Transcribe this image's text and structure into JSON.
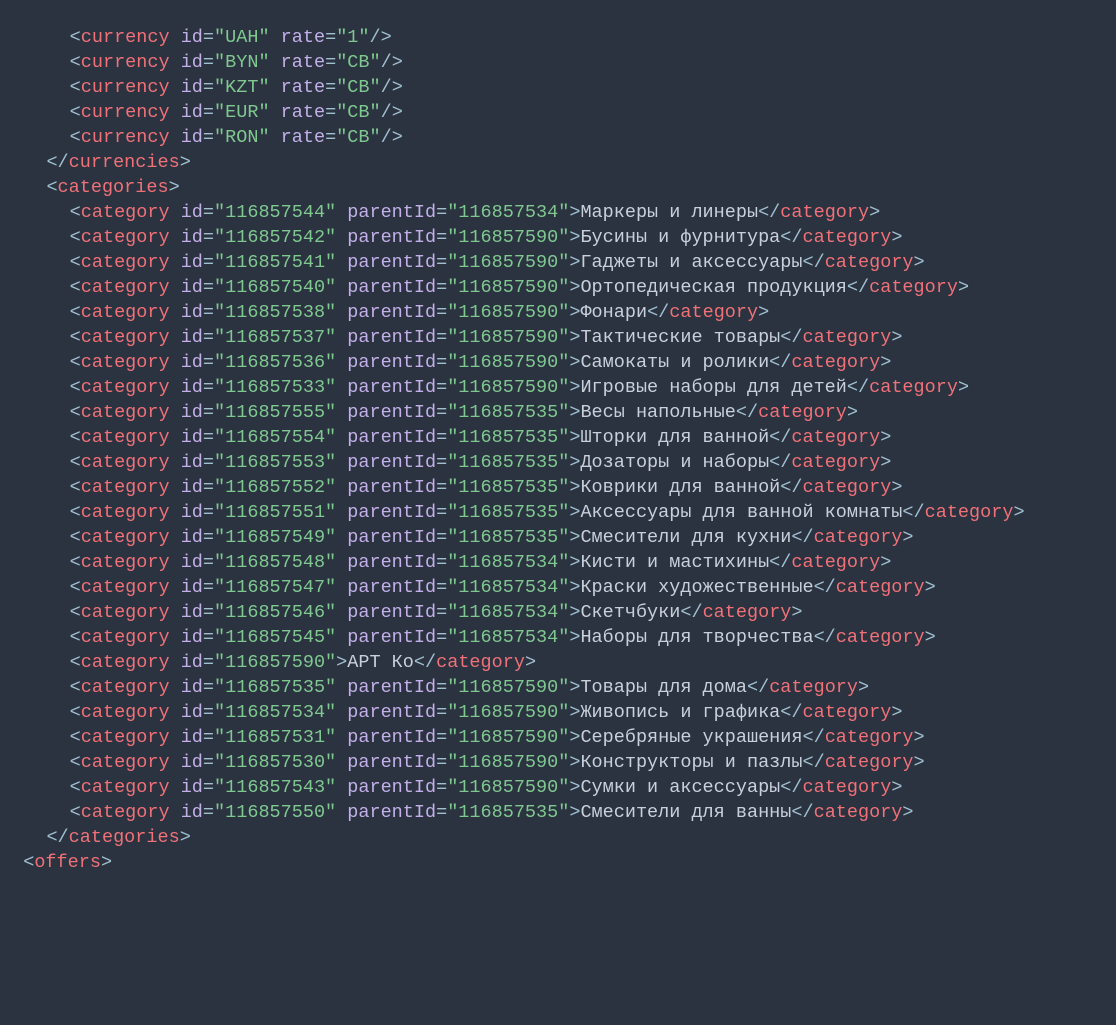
{
  "indentUnit": "  ",
  "currencies": {
    "indent": 3,
    "items": [
      {
        "id": "UAH",
        "rate": "1"
      },
      {
        "id": "BYN",
        "rate": "CB"
      },
      {
        "id": "KZT",
        "rate": "CB"
      },
      {
        "id": "EUR",
        "rate": "CB"
      },
      {
        "id": "RON",
        "rate": "CB"
      }
    ]
  },
  "currenciesClose": {
    "indent": 2,
    "tag": "currencies"
  },
  "categoriesOpen": {
    "indent": 2,
    "tag": "categories"
  },
  "categories": {
    "indent": 3,
    "items": [
      {
        "id": "116857544",
        "parentId": "116857534",
        "text": "Маркеры и линеры"
      },
      {
        "id": "116857542",
        "parentId": "116857590",
        "text": "Бусины и фурнитура"
      },
      {
        "id": "116857541",
        "parentId": "116857590",
        "text": "Гаджеты и аксессуары"
      },
      {
        "id": "116857540",
        "parentId": "116857590",
        "text": "Ортопедическая продукция"
      },
      {
        "id": "116857538",
        "parentId": "116857590",
        "text": "Фонари"
      },
      {
        "id": "116857537",
        "parentId": "116857590",
        "text": "Тактические товары"
      },
      {
        "id": "116857536",
        "parentId": "116857590",
        "text": "Самокаты и ролики"
      },
      {
        "id": "116857533",
        "parentId": "116857590",
        "text": "Игровые наборы для детей"
      },
      {
        "id": "116857555",
        "parentId": "116857535",
        "text": "Весы напольные"
      },
      {
        "id": "116857554",
        "parentId": "116857535",
        "text": "Шторки для ванной"
      },
      {
        "id": "116857553",
        "parentId": "116857535",
        "text": "Дозаторы и наборы"
      },
      {
        "id": "116857552",
        "parentId": "116857535",
        "text": "Коврики для ванной"
      },
      {
        "id": "116857551",
        "parentId": "116857535",
        "text": "Аксессуары для ванной комнаты"
      },
      {
        "id": "116857549",
        "parentId": "116857535",
        "text": "Смесители для кухни"
      },
      {
        "id": "116857548",
        "parentId": "116857534",
        "text": "Кисти и мастихины"
      },
      {
        "id": "116857547",
        "parentId": "116857534",
        "text": "Краски художественные"
      },
      {
        "id": "116857546",
        "parentId": "116857534",
        "text": "Скетчбуки"
      },
      {
        "id": "116857545",
        "parentId": "116857534",
        "text": "Наборы для творчества"
      },
      {
        "id": "116857590",
        "text": "АРТ Ко"
      },
      {
        "id": "116857535",
        "parentId": "116857590",
        "text": "Товары для дома"
      },
      {
        "id": "116857534",
        "parentId": "116857590",
        "text": "Живопись и графика"
      },
      {
        "id": "116857531",
        "parentId": "116857590",
        "text": "Серебряные украшения"
      },
      {
        "id": "116857530",
        "parentId": "116857590",
        "text": "Конструкторы и пазлы"
      },
      {
        "id": "116857543",
        "parentId": "116857590",
        "text": "Сумки и аксессуары"
      },
      {
        "id": "116857550",
        "parentId": "116857535",
        "text": "Смесители для ванны"
      }
    ]
  },
  "categoriesClose": {
    "indent": 2,
    "tag": "categories"
  },
  "offersOpen": {
    "indent": 1,
    "tag": "offers"
  }
}
